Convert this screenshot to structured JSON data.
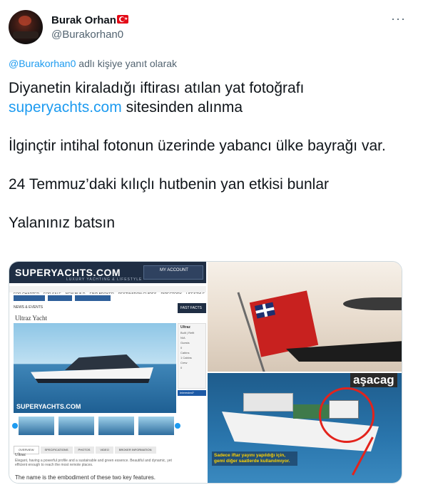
{
  "author": {
    "name": "Burak Orhan",
    "handle": "@Burakorhan0",
    "flag_icon": "turkey-flag-icon"
  },
  "reply_context": {
    "mention": "@Burakorhan0",
    "suffix": " adlı kişiye yanıt olarak"
  },
  "tweet": {
    "line1_a": "Diyanetin kiraladığı iftirası atılan yat fotoğrafı",
    "link": "superyachts.com",
    "line1_b": " sitesinden alınma",
    "para2": "İlginçtir intihal fotonun üzerinde yabancı ülke bayrağı var.",
    "para3": "24 Temmuz’daki kılıçlı hutbenin yan etkisi bunlar",
    "para4": "Yalanınız batsın"
  },
  "media": {
    "site_logo": "SUPERYACHTS.COM",
    "site_tagline": "LUXURY YACHTING & LIFESTYLE",
    "site_account": "MY ACCOUNT",
    "site_nav": [
      "FOR CHARTER",
      "FOR SALE",
      "NEW BUILD",
      "FIND BROKER",
      "DESTINATION GUIDES",
      "DIRECTORY",
      "LIFESTYLE",
      "NEWS & EVENTS"
    ],
    "site_fast": "FAST FACTS",
    "site_page_title": "Ultraz Yacht",
    "site_panel_title": "Ultraz",
    "site_panel_rows": [
      "Built | Refit",
      "N/A",
      "Guests",
      "0",
      "Cabins",
      "1 Cabins",
      "Crew",
      "0"
    ],
    "site_interested": "Interested?",
    "site_watermark": "SUPERYACHTS.COM",
    "site_tabs": [
      "OVERVIEW",
      "SPECIFICATIONS",
      "PHOTOS",
      "VIDEO",
      "BROKER INFORMATION"
    ],
    "site_desc_title": "Ultraz",
    "site_desc": "Elegant, having a powerful profile and a sustainable and green essence. Beautiful and dynamic, yet efficient enough to reach the most remote places.",
    "site_embodiment": "The name is the embodiment of these two key features.",
    "news_headline": "aşacag",
    "news_caption": "Sadece iftar yayını yapıldığı için, gemi diğer saatlerde kullanılmıyor."
  },
  "colors": {
    "link": "#1d9bf0",
    "secondary_text": "#536471",
    "text": "#0f1419"
  }
}
